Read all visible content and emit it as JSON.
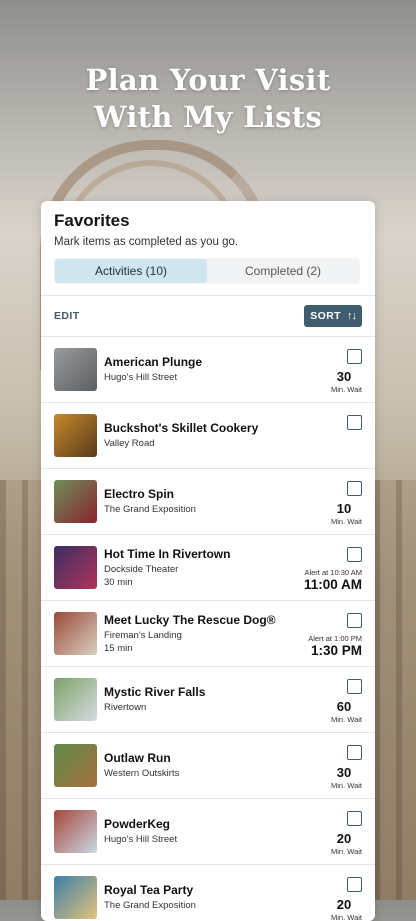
{
  "hero": {
    "line1": "Plan Your Visit",
    "line2": "With My Lists"
  },
  "favorites": {
    "title": "Favorites",
    "subtitle": "Mark items as completed as you go.",
    "tabs": [
      {
        "label": "Activities (10)",
        "active": true
      },
      {
        "label": "Completed (2)",
        "active": false
      }
    ],
    "edit_label": "EDIT",
    "sort_label": "SORT",
    "sort_icon": "sort-az-icon",
    "items": [
      {
        "name": "American Plunge",
        "location": "Hugo's Hill Street",
        "wait": "30",
        "wait_label": "Min. Wait",
        "thumb_colors": [
          "#9a9c9e",
          "#5b5e62"
        ]
      },
      {
        "name": "Buckshot's Skillet Cookery",
        "location": "Valley Road",
        "thumb_colors": [
          "#c78a2c",
          "#5a3a1a"
        ]
      },
      {
        "name": "Electro Spin",
        "location": "The Grand Exposition",
        "wait": "10",
        "wait_label": "Min. Wait",
        "thumb_colors": [
          "#6f8f58",
          "#8a2330"
        ]
      },
      {
        "name": "Hot Time In Rivertown",
        "location": "Dockside Theater",
        "duration": "30 min",
        "alert_label": "Alert at 10:30 AM",
        "alert_time": "11:00 AM",
        "thumb_colors": [
          "#3b2d63",
          "#b0345a"
        ]
      },
      {
        "name": "Meet Lucky The Rescue Dog®",
        "location": "Fireman's Landing",
        "duration": "15 min",
        "alert_label": "Alert at 1:00 PM",
        "alert_time": "1:30 PM",
        "thumb_colors": [
          "#9b4a3a",
          "#d8cfc0"
        ]
      },
      {
        "name": "Mystic River Falls",
        "location": "Rivertown",
        "wait": "60",
        "wait_label": "Min. Wait",
        "thumb_colors": [
          "#7da26a",
          "#d6dbe0"
        ]
      },
      {
        "name": "Outlaw Run",
        "location": "Western Outskirts",
        "wait": "30",
        "wait_label": "Min. Wait",
        "thumb_colors": [
          "#5e8a4a",
          "#a6703e"
        ]
      },
      {
        "name": "PowderKeg",
        "location": "Hugo's Hill Street",
        "wait": "20",
        "wait_label": "Min. Wait",
        "thumb_colors": [
          "#a6473b",
          "#c9d8e4"
        ]
      },
      {
        "name": "Royal Tea Party",
        "location": "The Grand Exposition",
        "wait": "20",
        "wait_label": "Min. Wait",
        "thumb_colors": [
          "#3c7fa6",
          "#e2c37d"
        ]
      }
    ]
  },
  "colors": {
    "accent": "#3f5d6e",
    "tab_active_bg": "#cfe6ee",
    "card_bg": "#ffffff"
  }
}
